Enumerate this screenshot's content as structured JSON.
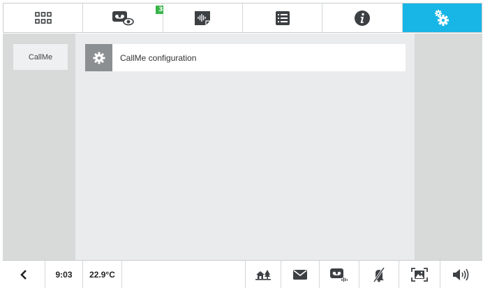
{
  "tabs": [
    {
      "icon": "apps-grid-icon"
    },
    {
      "icon": "voicemail-view-icon",
      "badge": "3"
    },
    {
      "icon": "audio-message-icon"
    },
    {
      "icon": "list-icon"
    },
    {
      "icon": "info-icon"
    },
    {
      "icon": "settings-gears-icon",
      "active": true
    }
  ],
  "sidebar": {
    "items": [
      {
        "label": "CallMe"
      }
    ]
  },
  "main": {
    "items": [
      {
        "label": "CallMe configuration",
        "icon": "gear-icon"
      }
    ]
  },
  "statusbar": {
    "time": "9:03",
    "temperature": "22.9°C"
  },
  "icons": {
    "back": "back-chevron-icon",
    "home": "home-tree-icon",
    "mail": "mail-icon",
    "voicemail": "voicemail-audio-icon",
    "mute": "mute-bell-icon",
    "fullscreen": "fullscreen-picture-icon",
    "volume": "volume-icon"
  },
  "colors": {
    "accent": "#18b6e6",
    "badge": "#39b54a",
    "sidebar_bg": "#d7dad9",
    "content_bg": "#e9ebec",
    "icon_dark": "#3d4043"
  }
}
